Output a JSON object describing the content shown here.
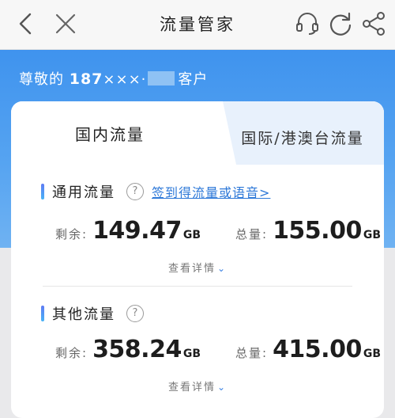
{
  "nav": {
    "title": "流量管家",
    "back_icon": "chevron-left-icon",
    "close_icon": "close-icon",
    "service_icon": "headset-icon",
    "refresh_icon": "refresh-icon",
    "share_icon": "share-icon"
  },
  "header": {
    "greet_prefix": "尊敬的",
    "number_visible": "187",
    "number_mask": "×××·",
    "greet_suffix": "客户",
    "band_color": "#4a9af0"
  },
  "tabs": [
    {
      "label": "国内流量",
      "active": true
    },
    {
      "label": "国际/港澳台流量",
      "active": false
    }
  ],
  "sections": [
    {
      "title": "通用流量",
      "promo_link": "签到得流量或语音>",
      "remaining_label": "剩余:",
      "remaining_value": "149.47",
      "remaining_unit": "GB",
      "total_label": "总量:",
      "total_value": "155.00",
      "total_unit": "GB",
      "detail_label": "查看详情"
    },
    {
      "title": "其他流量",
      "promo_link": "",
      "remaining_label": "剩余:",
      "remaining_value": "358.24",
      "remaining_unit": "GB",
      "total_label": "总量:",
      "total_value": "415.00",
      "total_unit": "GB",
      "detail_label": "查看详情"
    }
  ],
  "accent_color": "#2d78d8"
}
